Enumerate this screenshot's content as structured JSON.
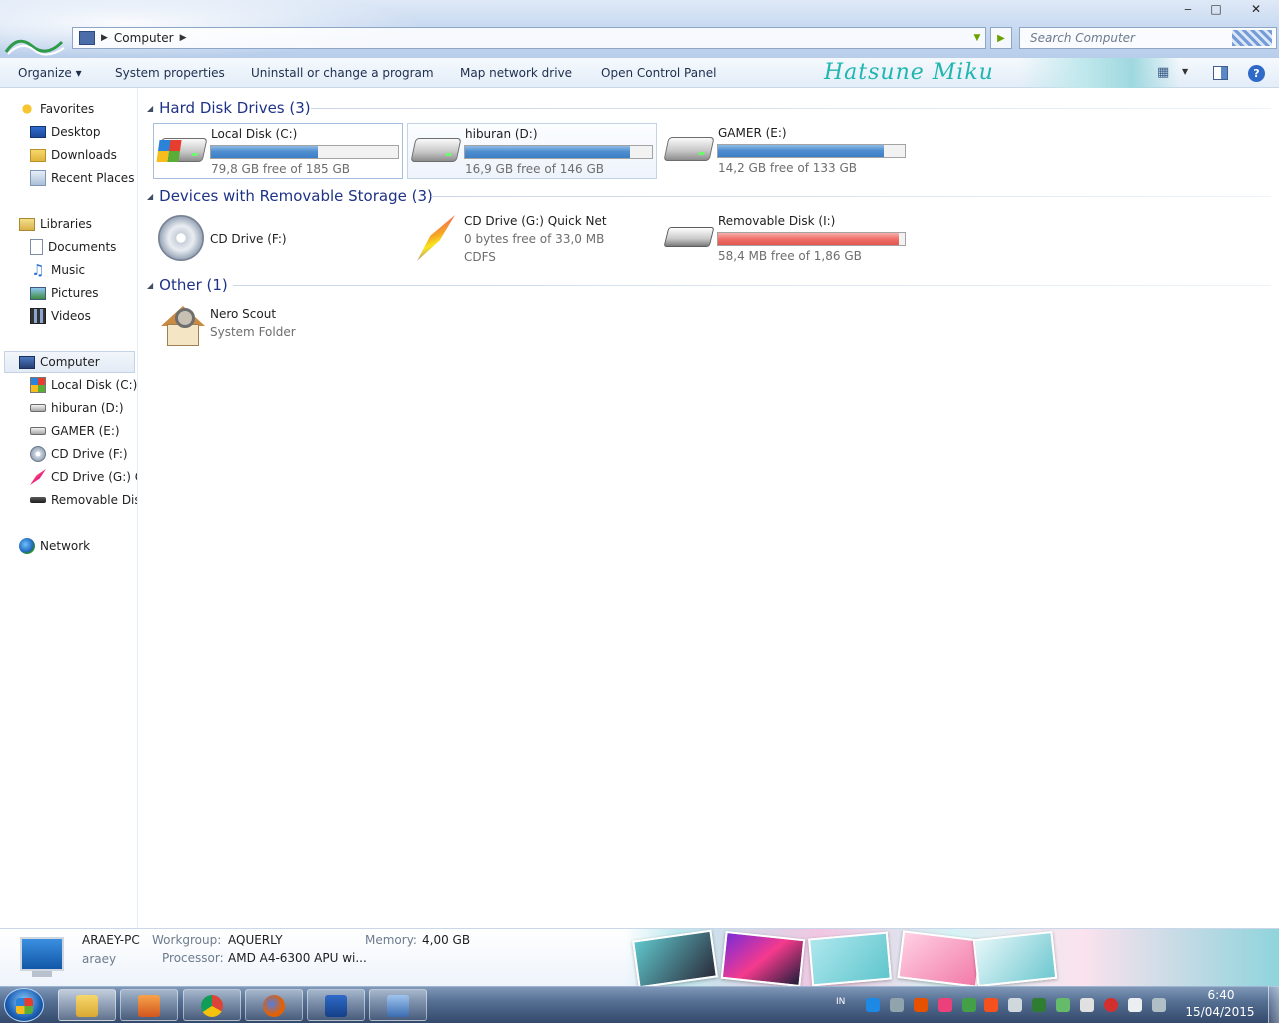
{
  "window": {
    "address_crumb": "Computer",
    "search_placeholder": "Search Computer",
    "min_label": "‒",
    "max_label": "□",
    "close_label": "✕"
  },
  "toolbar": {
    "organize": "Organize ▾",
    "system_properties": "System properties",
    "uninstall": "Uninstall or change a program",
    "map_drive": "Map network drive",
    "control_panel": "Open Control Panel",
    "brand_text": "Hatsune Miku"
  },
  "nav": {
    "favorites": "Favorites",
    "desktop": "Desktop",
    "downloads": "Downloads",
    "recent": "Recent Places",
    "libraries": "Libraries",
    "documents": "Documents",
    "music": "Music",
    "pictures": "Pictures",
    "videos": "Videos",
    "computer": "Computer",
    "drive_c": "Local Disk (C:)",
    "drive_d": "hiburan (D:)",
    "drive_e": "GAMER (E:)",
    "drive_f": "CD Drive (F:)",
    "drive_g": "CD Drive (G:) Q",
    "drive_i": "Removable Dis",
    "network": "Network"
  },
  "groups": {
    "hdd": "Hard Disk Drives (3)",
    "removable": "Devices with Removable Storage (3)",
    "other": "Other (1)"
  },
  "drives": {
    "c": {
      "name": "Local Disk (C:)",
      "free": "79,8 GB free of 185 GB",
      "used_fraction": 0.57
    },
    "d": {
      "name": "hiburan (D:)",
      "free": "16,9 GB free of 146 GB",
      "used_fraction": 0.88
    },
    "e": {
      "name": "GAMER (E:)",
      "free": "14,2 GB free of 133 GB",
      "used_fraction": 0.89
    },
    "f": {
      "name": "CD Drive (F:)"
    },
    "g": {
      "name": "CD Drive (G:) Quick Net",
      "free": "0 bytes free of 33,0 MB",
      "fs": "CDFS"
    },
    "i": {
      "name": "Removable Disk (I:)",
      "free": "58,4 MB free of 1,86 GB",
      "used_fraction": 0.97
    }
  },
  "other_items": {
    "nero": {
      "name": "Nero Scout",
      "type": "System Folder"
    }
  },
  "details": {
    "pc_name": "ARAEY-PC",
    "user": "araey",
    "workgroup_label": "Workgroup:",
    "workgroup": "AQUERLY",
    "memory_label": "Memory:",
    "memory": "4,00 GB",
    "processor_label": "Processor:",
    "processor": "AMD A4-6300 APU wi..."
  },
  "taskbar": {
    "lang": "IN",
    "time": "6:40",
    "date": "15/04/2015"
  },
  "colors": {
    "accent": "#1e3287",
    "bar_blue": "#4f8fd0",
    "bar_red": "#ef6f69",
    "brand": "#1fb6b0"
  }
}
